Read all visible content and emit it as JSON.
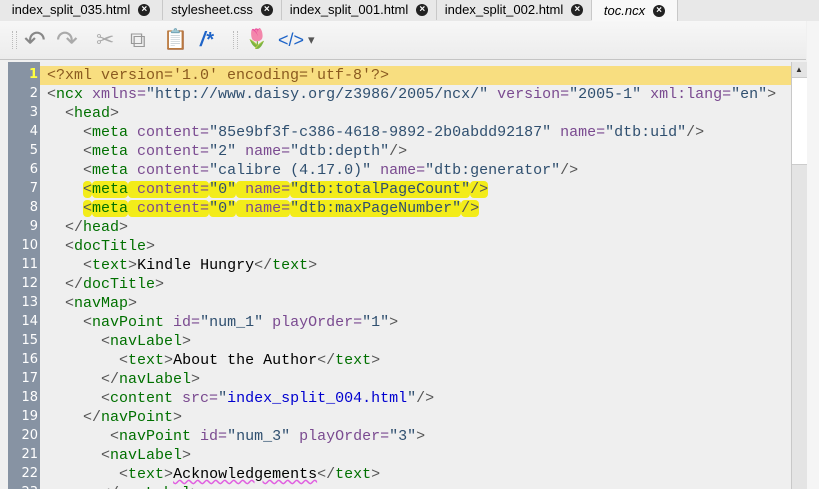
{
  "tabs": [
    {
      "label": "index_split_035.html"
    },
    {
      "label": "stylesheet.css"
    },
    {
      "label": "index_split_001.html"
    },
    {
      "label": "index_split_002.html"
    },
    {
      "label": "toc.ncx",
      "active": true
    }
  ],
  "toolbar": {
    "undo": "↶",
    "redo": "↷",
    "cut": "✂",
    "copy": "⧉",
    "paste": "📋",
    "comment": "/*",
    "tulip": "🌷",
    "code": "</>",
    "dropdown": "▾"
  },
  "editor": {
    "current_line": 1,
    "highlighted_lines": [
      7,
      8
    ],
    "lines": [
      [
        [
          "c",
          "<?xml version='1.0' encoding='utf-8'?>"
        ]
      ],
      [
        [
          "b",
          "<"
        ],
        [
          "t",
          "ncx"
        ],
        [
          "a",
          " xmlns="
        ],
        [
          "v",
          "\"http://www.daisy.org/z3986/2005/ncx/\""
        ],
        [
          "a",
          " version="
        ],
        [
          "v",
          "\"2005-1\""
        ],
        [
          "a",
          " xml:lang="
        ],
        [
          "v",
          "\"en\""
        ],
        [
          "b",
          ">"
        ]
      ],
      [
        [
          "x2",
          "  "
        ],
        [
          "b",
          "<"
        ],
        [
          "t",
          "head"
        ],
        [
          "b",
          ">"
        ]
      ],
      [
        [
          "x2",
          "    "
        ],
        [
          "b",
          "<"
        ],
        [
          "t",
          "meta"
        ],
        [
          "a",
          " content="
        ],
        [
          "v",
          "\"85e9bf3f-c386-4618-9892-2b0abdd92187\""
        ],
        [
          "a",
          " name="
        ],
        [
          "v",
          "\"dtb:uid\""
        ],
        [
          "b",
          "/>"
        ]
      ],
      [
        [
          "x2",
          "    "
        ],
        [
          "b",
          "<"
        ],
        [
          "t",
          "meta"
        ],
        [
          "a",
          " content="
        ],
        [
          "v",
          "\"2\""
        ],
        [
          "a",
          " name="
        ],
        [
          "v",
          "\"dtb:depth\""
        ],
        [
          "b",
          "/>"
        ]
      ],
      [
        [
          "x2",
          "    "
        ],
        [
          "b",
          "<"
        ],
        [
          "t",
          "meta"
        ],
        [
          "a",
          " content="
        ],
        [
          "v",
          "\"calibre (4.17.0)\""
        ],
        [
          "a",
          " name="
        ],
        [
          "v",
          "\"dtb:generator\""
        ],
        [
          "b",
          "/>"
        ]
      ],
      [
        [
          "x2",
          "    "
        ],
        [
          "b",
          "<"
        ],
        [
          "t",
          "meta"
        ],
        [
          "a",
          " content="
        ],
        [
          "v",
          "\"0\""
        ],
        [
          "a",
          " name="
        ],
        [
          "v",
          "\"dtb:totalPageCount\""
        ],
        [
          "b",
          "/>"
        ]
      ],
      [
        [
          "x2",
          "    "
        ],
        [
          "b",
          "<"
        ],
        [
          "t",
          "meta"
        ],
        [
          "a",
          " content="
        ],
        [
          "v",
          "\"0\""
        ],
        [
          "a",
          " name="
        ],
        [
          "v",
          "\"dtb:maxPageNumber\""
        ],
        [
          "b",
          "/>"
        ]
      ],
      [
        [
          "x2",
          "  "
        ],
        [
          "b",
          "</"
        ],
        [
          "t",
          "head"
        ],
        [
          "b",
          ">"
        ]
      ],
      [
        [
          "x2",
          "  "
        ],
        [
          "b",
          "<"
        ],
        [
          "t",
          "docTitle"
        ],
        [
          "b",
          ">"
        ]
      ],
      [
        [
          "x2",
          "    "
        ],
        [
          "b",
          "<"
        ],
        [
          "t",
          "text"
        ],
        [
          "b",
          ">"
        ],
        [
          "x2",
          "Kindle Hungry"
        ],
        [
          "b",
          "</"
        ],
        [
          "t",
          "text"
        ],
        [
          "b",
          ">"
        ]
      ],
      [
        [
          "x2",
          "  "
        ],
        [
          "b",
          "</"
        ],
        [
          "t",
          "docTitle"
        ],
        [
          "b",
          ">"
        ]
      ],
      [
        [
          "x2",
          "  "
        ],
        [
          "b",
          "<"
        ],
        [
          "t",
          "navMap"
        ],
        [
          "b",
          ">"
        ]
      ],
      [
        [
          "x2",
          "    "
        ],
        [
          "b",
          "<"
        ],
        [
          "t",
          "navPoint"
        ],
        [
          "a",
          " id="
        ],
        [
          "v",
          "\"num_1\""
        ],
        [
          "a",
          " playOrder="
        ],
        [
          "v",
          "\"1\""
        ],
        [
          "b",
          ">"
        ]
      ],
      [
        [
          "x2",
          "      "
        ],
        [
          "b",
          "<"
        ],
        [
          "t",
          "navLabel"
        ],
        [
          "b",
          ">"
        ]
      ],
      [
        [
          "x2",
          "        "
        ],
        [
          "b",
          "<"
        ],
        [
          "t",
          "text"
        ],
        [
          "b",
          ">"
        ],
        [
          "x2",
          "About the Author"
        ],
        [
          "b",
          "</"
        ],
        [
          "t",
          "text"
        ],
        [
          "b",
          ">"
        ]
      ],
      [
        [
          "x2",
          "      "
        ],
        [
          "b",
          "</"
        ],
        [
          "t",
          "navLabel"
        ],
        [
          "b",
          ">"
        ]
      ],
      [
        [
          "x2",
          "      "
        ],
        [
          "b",
          "<"
        ],
        [
          "t",
          "content"
        ],
        [
          "a",
          " src="
        ],
        [
          "v",
          "\""
        ],
        [
          "l",
          "index_split_004.html"
        ],
        [
          "v",
          "\""
        ],
        [
          "b",
          "/>"
        ]
      ],
      [
        [
          "x2",
          "    "
        ],
        [
          "b",
          "</"
        ],
        [
          "t",
          "navPoint"
        ],
        [
          "b",
          ">"
        ]
      ],
      [
        [
          "x2",
          "       "
        ],
        [
          "b",
          "<"
        ],
        [
          "t",
          "navPoint"
        ],
        [
          "a",
          " id="
        ],
        [
          "v",
          "\"num_3\""
        ],
        [
          "a",
          " playOrder="
        ],
        [
          "v",
          "\"3\""
        ],
        [
          "b",
          ">"
        ]
      ],
      [
        [
          "x2",
          "      "
        ],
        [
          "b",
          "<"
        ],
        [
          "t",
          "navLabel"
        ],
        [
          "b",
          ">"
        ]
      ],
      [
        [
          "x2",
          "        "
        ],
        [
          "b",
          "<"
        ],
        [
          "t",
          "text"
        ],
        [
          "b",
          ">"
        ],
        [
          "sp",
          "Acknowledgements"
        ],
        [
          "b",
          "</"
        ],
        [
          "t",
          "text"
        ],
        [
          "b",
          ">"
        ]
      ],
      [
        [
          "x2",
          "      "
        ],
        [
          "b",
          "</"
        ],
        [
          "t",
          "navLabel"
        ],
        [
          "b",
          ">"
        ]
      ]
    ]
  }
}
